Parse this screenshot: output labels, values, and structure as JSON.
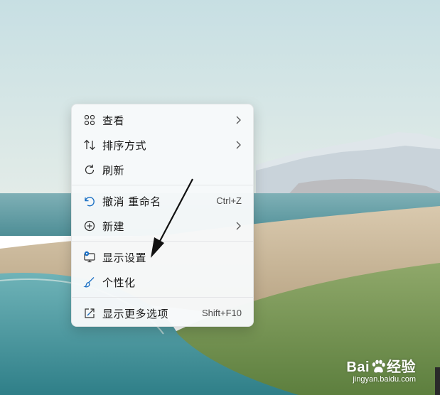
{
  "context_menu": {
    "items": [
      {
        "label": "查看",
        "icon": "grid-icon",
        "submenu": true
      },
      {
        "label": "排序方式",
        "icon": "sort-arrows-icon",
        "submenu": true
      },
      {
        "label": "刷新",
        "icon": "refresh-icon",
        "submenu": false
      },
      {
        "label": "撤消 重命名",
        "icon": "undo-icon",
        "shortcut": "Ctrl+Z"
      },
      {
        "label": "新建",
        "icon": "plus-circle-icon",
        "submenu": true
      },
      {
        "label": "显示设置",
        "icon": "display-settings-icon",
        "submenu": false
      },
      {
        "label": "个性化",
        "icon": "brush-icon",
        "submenu": false
      },
      {
        "label": "显示更多选项",
        "icon": "open-external-icon",
        "shortcut": "Shift+F10"
      }
    ]
  },
  "colors": {
    "accent": "#1a6fc4",
    "menu_bg": "#f7f9fa",
    "text": "#1b1b1b"
  },
  "watermark": {
    "brand_left": "Bai",
    "brand_right": "经验",
    "url": "jingyan.baidu.com"
  }
}
